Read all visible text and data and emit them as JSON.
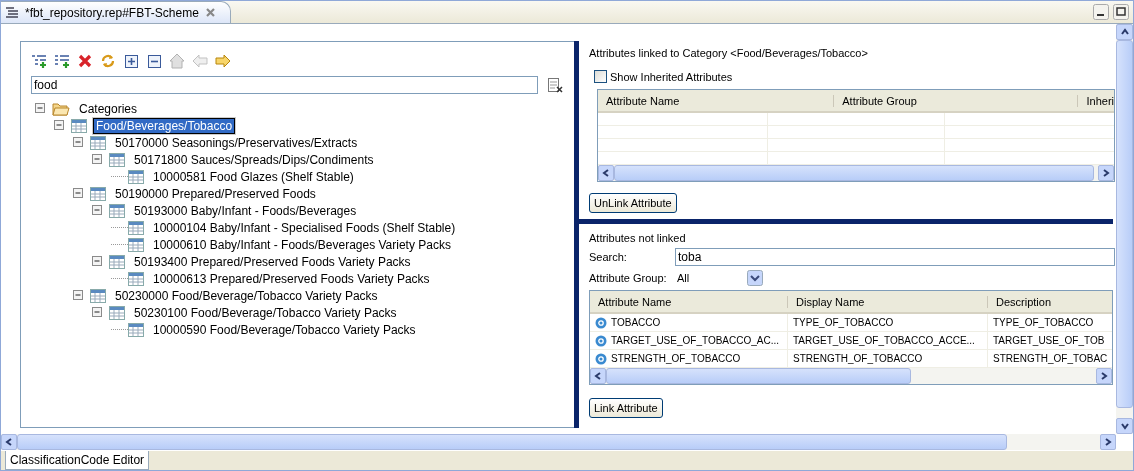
{
  "editor_tab": {
    "title": "*fbt_repository.rep#FBT-Scheme",
    "selected": true
  },
  "toolbar": [
    {
      "kind": "add-child",
      "disabled": false
    },
    {
      "kind": "add-sibling",
      "disabled": false
    },
    {
      "kind": "delete",
      "disabled": false
    },
    {
      "kind": "refresh",
      "disabled": false
    },
    {
      "kind": "expand",
      "disabled": false
    },
    {
      "kind": "collapse",
      "disabled": false
    },
    {
      "kind": "home",
      "disabled": true
    },
    {
      "kind": "back",
      "disabled": true
    },
    {
      "kind": "forward",
      "disabled": false
    }
  ],
  "filter": {
    "value": "food"
  },
  "tree": [
    {
      "label": "Categories",
      "kind": "folder",
      "expanded": true,
      "selected": false,
      "children": [
        {
          "label": "Food/Beverages/Tobacco",
          "kind": "category",
          "expanded": true,
          "selected": true,
          "children": [
            {
              "label": "50170000 Seasonings/Preservatives/Extracts",
              "kind": "category",
              "expanded": true,
              "selected": false,
              "children": [
                {
                  "label": "50171800 Sauces/Spreads/Dips/Condiments",
                  "kind": "category",
                  "expanded": true,
                  "selected": false,
                  "children": [
                    {
                      "label": "10000581 Food Glazes (Shelf Stable)",
                      "kind": "category",
                      "selected": false
                    }
                  ]
                }
              ]
            },
            {
              "label": "50190000 Prepared/Preserved Foods",
              "kind": "category",
              "expanded": true,
              "selected": false,
              "children": [
                {
                  "label": "50193000 Baby/Infant - Foods/Beverages",
                  "kind": "category",
                  "expanded": true,
                  "selected": false,
                  "children": [
                    {
                      "label": "10000104 Baby/Infant - Specialised Foods (Shelf Stable)",
                      "kind": "category",
                      "selected": false
                    },
                    {
                      "label": "10000610 Baby/Infant - Foods/Beverages Variety Packs",
                      "kind": "category",
                      "selected": false
                    }
                  ]
                },
                {
                  "label": "50193400 Prepared/Preserved Foods Variety Packs",
                  "kind": "category",
                  "expanded": true,
                  "selected": false,
                  "children": [
                    {
                      "label": "10000613 Prepared/Preserved Foods Variety Packs",
                      "kind": "category",
                      "selected": false
                    }
                  ]
                }
              ]
            },
            {
              "label": "50230000 Food/Beverage/Tobacco Variety Packs",
              "kind": "category",
              "expanded": true,
              "selected": false,
              "children": [
                {
                  "label": "50230100 Food/Beverage/Tobacco Variety Packs",
                  "kind": "category",
                  "expanded": true,
                  "selected": false,
                  "children": [
                    {
                      "label": "10000590 Food/Beverage/Tobacco Variety Packs",
                      "kind": "category",
                      "selected": false
                    }
                  ]
                }
              ]
            }
          ]
        }
      ]
    }
  ],
  "linked": {
    "title": "Attributes linked to Category <Food/Beverages/Tobacco>",
    "show_inherited": {
      "label": "Show Inherited Attributes",
      "checked": false
    },
    "columns": [
      "Attribute Name",
      "Attribute Group",
      "Inheri"
    ],
    "button": "UnLink Attribute"
  },
  "unlinked": {
    "title": "Attributes not linked",
    "search_label": "Search:",
    "search_value": "toba",
    "group_label": "Attribute Group:",
    "group_value": "All",
    "columns": [
      "Attribute Name",
      "Display Name",
      "Description"
    ],
    "rows": [
      [
        "TOBACCO",
        "TYPE_OF_TOBACCO",
        "TYPE_OF_TOBACCO"
      ],
      [
        "TARGET_USE_OF_TOBACCO_AC...",
        "TARGET_USE_OF_TOBACCO_ACCE...",
        "TARGET_USE_OF_TOB"
      ],
      [
        "STRENGTH_OF_TOBACCO",
        "STRENGTH_OF_TOBACCO",
        "STRENGTH_OF_TOBAC"
      ]
    ],
    "button": "Link Attribute"
  },
  "bottom_tab": {
    "label": "ClassificationCode Editor",
    "selected": true
  }
}
